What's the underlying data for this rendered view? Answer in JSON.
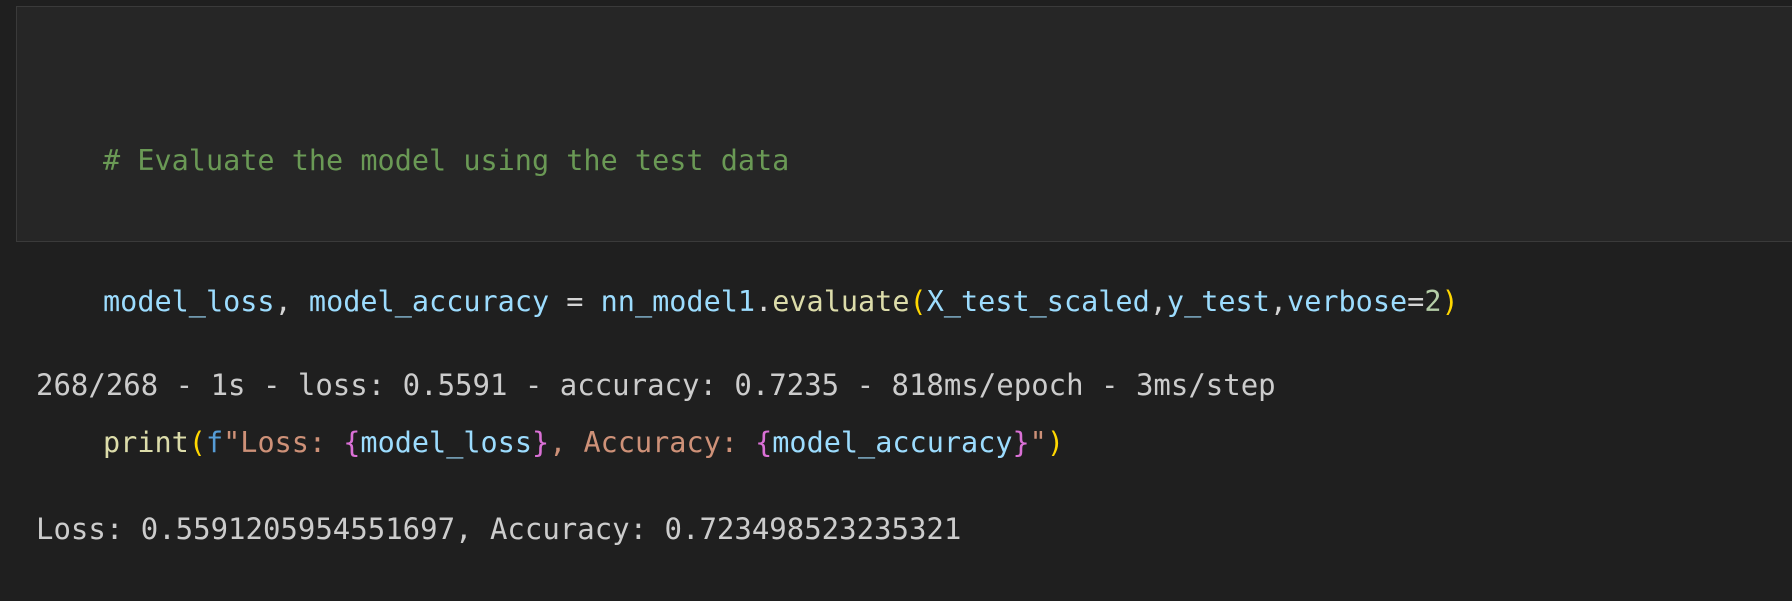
{
  "cell": {
    "code": {
      "line1": {
        "comment": "# Evaluate the model using the test data"
      },
      "line2": {
        "var_loss": "model_loss",
        "comma_sp": ", ",
        "var_accuracy": "model_accuracy",
        "equals": " = ",
        "model_name": "nn_model1",
        "dot": ".",
        "method": "evaluate",
        "open_paren": "(",
        "arg1": "X_test_scaled",
        "comma1": ",",
        "arg2": "y_test",
        "comma2": ",",
        "kw": "verbose",
        "eq": "=",
        "num": "2",
        "close_paren": ")"
      },
      "line3": {
        "func": "print",
        "open_paren": "(",
        "fprefix": "f",
        "str1": "\"Loss: ",
        "brace_open1": "{",
        "var1": "model_loss",
        "brace_close1": "}",
        "str2": ", Accuracy: ",
        "brace_open2": "{",
        "var2": "model_accuracy",
        "brace_close2": "}",
        "str3": "\"",
        "close_paren": ")"
      }
    },
    "output": {
      "line1": "268/268 - 1s - loss: 0.5591 - accuracy: 0.7235 - 818ms/epoch - 3ms/step",
      "line2": "Loss: 0.5591205954551697, Accuracy: 0.723498523235321"
    }
  },
  "colors": {
    "background": "#1f1f1f",
    "editor_background": "#262626",
    "comment": "#6a9955",
    "variable": "#9cdcfe",
    "function": "#dcdcaa",
    "string": "#ce9178",
    "number": "#b5cea8",
    "bracket_level1": "#ffd700",
    "bracket_level2": "#da70d6",
    "keyword": "#569cd6",
    "output_text": "#cccccc"
  }
}
